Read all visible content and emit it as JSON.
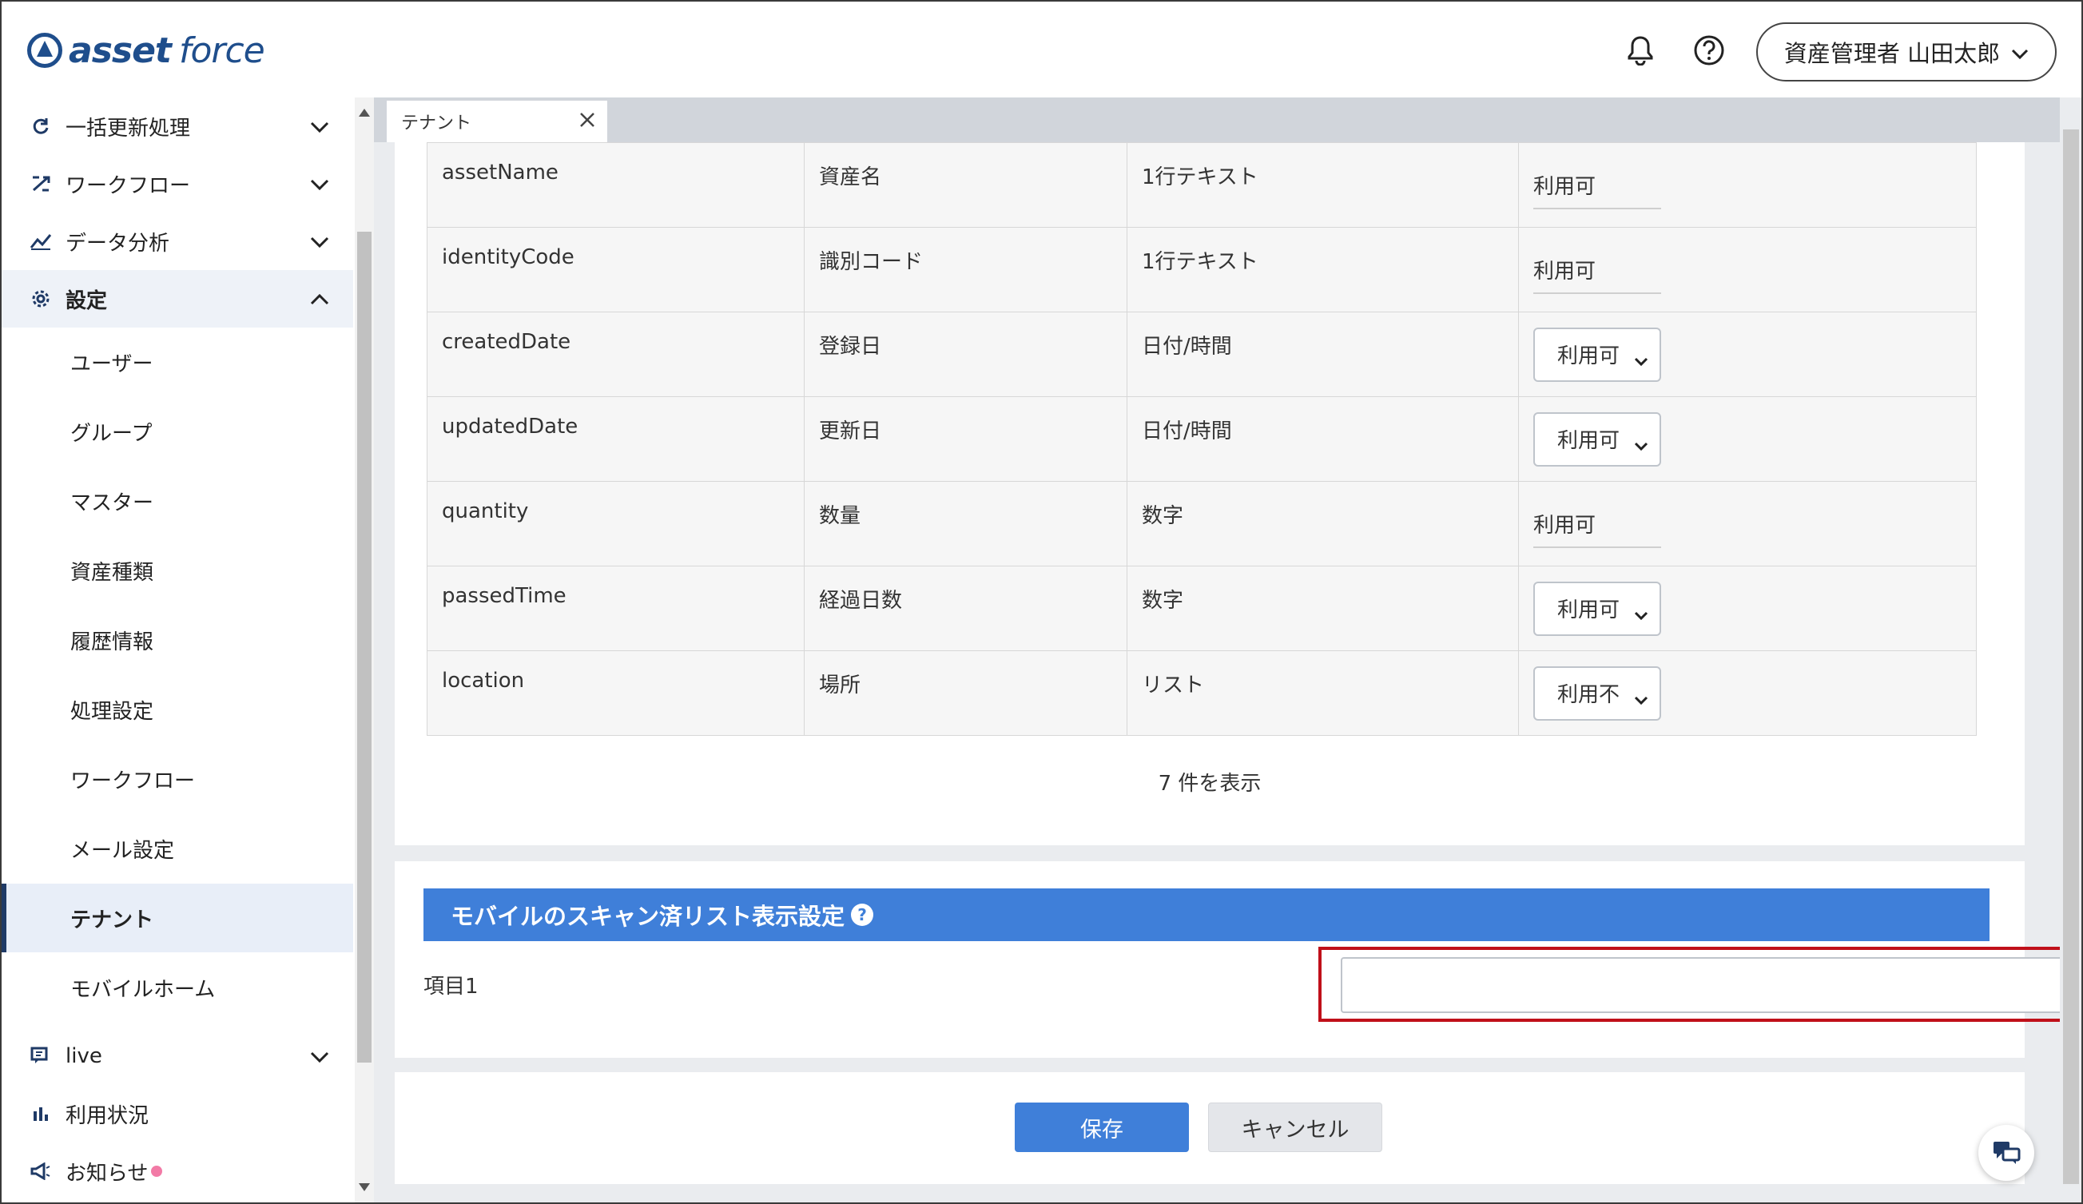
{
  "header": {
    "logo_bold": "asset",
    "logo_light": "force",
    "user_label": "資産管理者 山田太郎"
  },
  "sidebar": {
    "top_items": [
      {
        "label": "一括更新処理",
        "icon": "refresh-icon"
      },
      {
        "label": "ワークフロー",
        "icon": "workflow-icon"
      },
      {
        "label": "データ分析",
        "icon": "analytics-icon"
      },
      {
        "label": "設定",
        "icon": "gear-icon"
      }
    ],
    "settings_items": [
      {
        "label": "ユーザー"
      },
      {
        "label": "グループ"
      },
      {
        "label": "マスター"
      },
      {
        "label": "資産種類"
      },
      {
        "label": "履歴情報"
      },
      {
        "label": "処理設定"
      },
      {
        "label": "ワークフロー"
      },
      {
        "label": "メール設定"
      },
      {
        "label": "テナント"
      },
      {
        "label": "モバイルホーム"
      }
    ],
    "bottom_items": [
      {
        "label": "live",
        "icon": "chat-icon"
      },
      {
        "label": "利用状況",
        "icon": "bar-chart-icon"
      },
      {
        "label": "お知らせ",
        "icon": "megaphone-icon"
      }
    ]
  },
  "tab": {
    "label": "テナント"
  },
  "fields_table": {
    "rows": [
      {
        "key": "assetName",
        "name": "資産名",
        "type": "1行テキスト",
        "value": "利用可",
        "editable": false
      },
      {
        "key": "identityCode",
        "name": "識別コード",
        "type": "1行テキスト",
        "value": "利用可",
        "editable": false
      },
      {
        "key": "createdDate",
        "name": "登録日",
        "type": "日付/時間",
        "value": "利用可",
        "editable": true
      },
      {
        "key": "updatedDate",
        "name": "更新日",
        "type": "日付/時間",
        "value": "利用可",
        "editable": true
      },
      {
        "key": "quantity",
        "name": "数量",
        "type": "数字",
        "value": "利用可",
        "editable": false
      },
      {
        "key": "passedTime",
        "name": "経過日数",
        "type": "数字",
        "value": "利用可",
        "editable": true
      },
      {
        "key": "location",
        "name": "場所",
        "type": "リスト",
        "value": "利用不",
        "editable": true
      }
    ],
    "count_text": "7 件を表示"
  },
  "mobile_section": {
    "title": "モバイルのスキャン済リスト表示設定",
    "help": "?",
    "item_label": "項目1",
    "item_value": ""
  },
  "actions": {
    "save": "保存",
    "cancel": "キャンセル"
  },
  "colors": {
    "brand": "#1f4e8c",
    "accent": "#3f7fd9",
    "highlight": "#c0101a",
    "notice_dot": "#f27aa6"
  }
}
